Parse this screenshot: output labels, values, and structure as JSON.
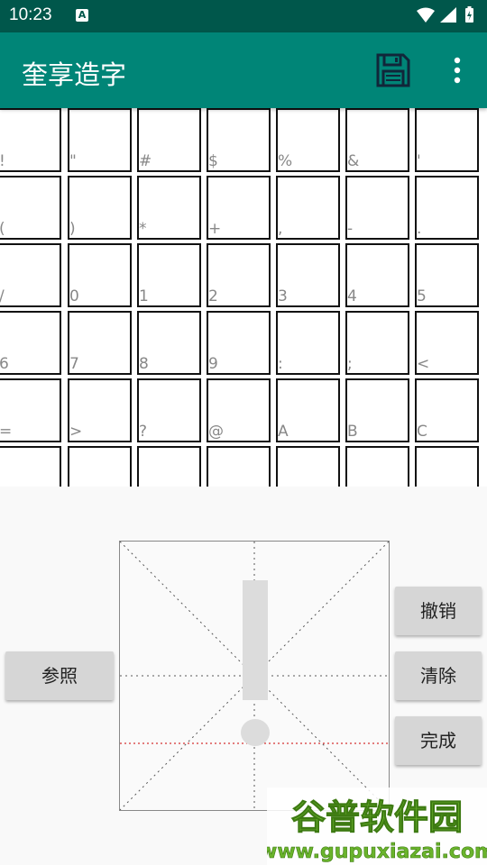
{
  "status_bar": {
    "time": "10:23",
    "notification_badge": "A",
    "icons": [
      "wifi-icon",
      "signal-icon",
      "battery-icon"
    ]
  },
  "app_bar": {
    "title": "奎享造字",
    "actions": [
      "save-icon",
      "more-vert-icon"
    ]
  },
  "glyph_grid": {
    "rows": [
      [
        "!",
        "\"",
        "#",
        "$",
        "%",
        "&",
        "'"
      ],
      [
        "(",
        ")",
        "*",
        "+",
        ",",
        "-",
        "."
      ],
      [
        "/",
        "0",
        "1",
        "2",
        "3",
        "4",
        "5"
      ],
      [
        "6",
        "7",
        "8",
        "9",
        ":",
        ";",
        "<"
      ],
      [
        "=",
        ">",
        "?",
        "@",
        "A",
        "B",
        "C"
      ],
      [
        "",
        "",
        "",
        "",
        "",
        "",
        ""
      ]
    ]
  },
  "editor": {
    "reference_button": "参照",
    "undo_button": "撤销",
    "clear_button": "清除",
    "done_button": "完成",
    "reference_glyph": "!"
  },
  "watermark": {
    "brand": "谷普软件园",
    "url": "www.gupuxiazai.com"
  },
  "colors": {
    "status_bar": "#00574b",
    "app_bar": "#008577",
    "baseline": "#cc0000",
    "watermark_green": "#6ab42c"
  }
}
